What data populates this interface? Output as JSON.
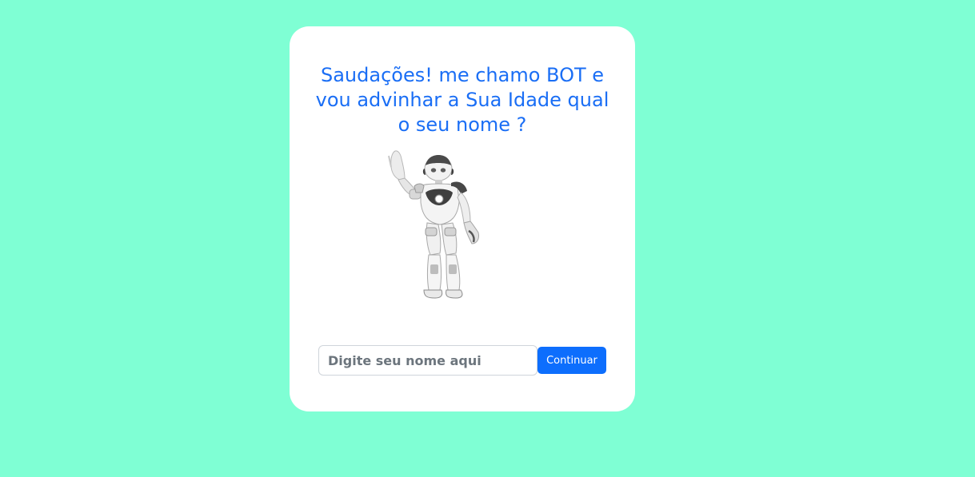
{
  "greeting": {
    "text": "Saudações! me chamo BOT e vou advinhar a Sua Idade qual o seu nome ?"
  },
  "robot_image": {
    "icon": "waving-robot-illustration"
  },
  "form": {
    "name_placeholder": "Digite seu nome aqui",
    "name_value": "",
    "continue_label": "Continuar"
  },
  "colors": {
    "background": "#7fffd4",
    "card": "#ffffff",
    "title": "#1a6ef5",
    "button": "#0d6efd"
  }
}
